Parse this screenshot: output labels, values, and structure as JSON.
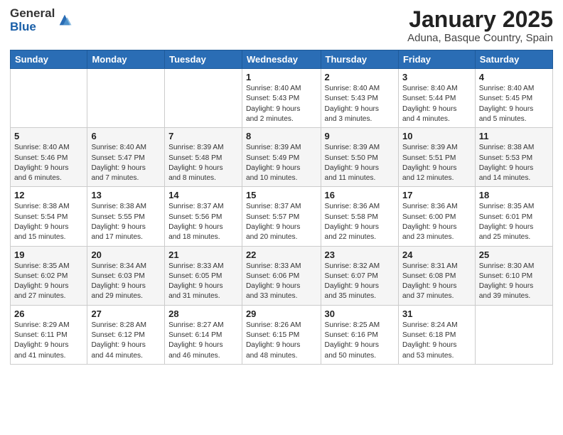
{
  "header": {
    "logo_general": "General",
    "logo_blue": "Blue",
    "title": "January 2025",
    "subtitle": "Aduna, Basque Country, Spain"
  },
  "weekdays": [
    "Sunday",
    "Monday",
    "Tuesday",
    "Wednesday",
    "Thursday",
    "Friday",
    "Saturday"
  ],
  "weeks": [
    [
      {
        "day": "",
        "info": ""
      },
      {
        "day": "",
        "info": ""
      },
      {
        "day": "",
        "info": ""
      },
      {
        "day": "1",
        "info": "Sunrise: 8:40 AM\nSunset: 5:43 PM\nDaylight: 9 hours\nand 2 minutes."
      },
      {
        "day": "2",
        "info": "Sunrise: 8:40 AM\nSunset: 5:43 PM\nDaylight: 9 hours\nand 3 minutes."
      },
      {
        "day": "3",
        "info": "Sunrise: 8:40 AM\nSunset: 5:44 PM\nDaylight: 9 hours\nand 4 minutes."
      },
      {
        "day": "4",
        "info": "Sunrise: 8:40 AM\nSunset: 5:45 PM\nDaylight: 9 hours\nand 5 minutes."
      }
    ],
    [
      {
        "day": "5",
        "info": "Sunrise: 8:40 AM\nSunset: 5:46 PM\nDaylight: 9 hours\nand 6 minutes."
      },
      {
        "day": "6",
        "info": "Sunrise: 8:40 AM\nSunset: 5:47 PM\nDaylight: 9 hours\nand 7 minutes."
      },
      {
        "day": "7",
        "info": "Sunrise: 8:39 AM\nSunset: 5:48 PM\nDaylight: 9 hours\nand 8 minutes."
      },
      {
        "day": "8",
        "info": "Sunrise: 8:39 AM\nSunset: 5:49 PM\nDaylight: 9 hours\nand 10 minutes."
      },
      {
        "day": "9",
        "info": "Sunrise: 8:39 AM\nSunset: 5:50 PM\nDaylight: 9 hours\nand 11 minutes."
      },
      {
        "day": "10",
        "info": "Sunrise: 8:39 AM\nSunset: 5:51 PM\nDaylight: 9 hours\nand 12 minutes."
      },
      {
        "day": "11",
        "info": "Sunrise: 8:38 AM\nSunset: 5:53 PM\nDaylight: 9 hours\nand 14 minutes."
      }
    ],
    [
      {
        "day": "12",
        "info": "Sunrise: 8:38 AM\nSunset: 5:54 PM\nDaylight: 9 hours\nand 15 minutes."
      },
      {
        "day": "13",
        "info": "Sunrise: 8:38 AM\nSunset: 5:55 PM\nDaylight: 9 hours\nand 17 minutes."
      },
      {
        "day": "14",
        "info": "Sunrise: 8:37 AM\nSunset: 5:56 PM\nDaylight: 9 hours\nand 18 minutes."
      },
      {
        "day": "15",
        "info": "Sunrise: 8:37 AM\nSunset: 5:57 PM\nDaylight: 9 hours\nand 20 minutes."
      },
      {
        "day": "16",
        "info": "Sunrise: 8:36 AM\nSunset: 5:58 PM\nDaylight: 9 hours\nand 22 minutes."
      },
      {
        "day": "17",
        "info": "Sunrise: 8:36 AM\nSunset: 6:00 PM\nDaylight: 9 hours\nand 23 minutes."
      },
      {
        "day": "18",
        "info": "Sunrise: 8:35 AM\nSunset: 6:01 PM\nDaylight: 9 hours\nand 25 minutes."
      }
    ],
    [
      {
        "day": "19",
        "info": "Sunrise: 8:35 AM\nSunset: 6:02 PM\nDaylight: 9 hours\nand 27 minutes."
      },
      {
        "day": "20",
        "info": "Sunrise: 8:34 AM\nSunset: 6:03 PM\nDaylight: 9 hours\nand 29 minutes."
      },
      {
        "day": "21",
        "info": "Sunrise: 8:33 AM\nSunset: 6:05 PM\nDaylight: 9 hours\nand 31 minutes."
      },
      {
        "day": "22",
        "info": "Sunrise: 8:33 AM\nSunset: 6:06 PM\nDaylight: 9 hours\nand 33 minutes."
      },
      {
        "day": "23",
        "info": "Sunrise: 8:32 AM\nSunset: 6:07 PM\nDaylight: 9 hours\nand 35 minutes."
      },
      {
        "day": "24",
        "info": "Sunrise: 8:31 AM\nSunset: 6:08 PM\nDaylight: 9 hours\nand 37 minutes."
      },
      {
        "day": "25",
        "info": "Sunrise: 8:30 AM\nSunset: 6:10 PM\nDaylight: 9 hours\nand 39 minutes."
      }
    ],
    [
      {
        "day": "26",
        "info": "Sunrise: 8:29 AM\nSunset: 6:11 PM\nDaylight: 9 hours\nand 41 minutes."
      },
      {
        "day": "27",
        "info": "Sunrise: 8:28 AM\nSunset: 6:12 PM\nDaylight: 9 hours\nand 44 minutes."
      },
      {
        "day": "28",
        "info": "Sunrise: 8:27 AM\nSunset: 6:14 PM\nDaylight: 9 hours\nand 46 minutes."
      },
      {
        "day": "29",
        "info": "Sunrise: 8:26 AM\nSunset: 6:15 PM\nDaylight: 9 hours\nand 48 minutes."
      },
      {
        "day": "30",
        "info": "Sunrise: 8:25 AM\nSunset: 6:16 PM\nDaylight: 9 hours\nand 50 minutes."
      },
      {
        "day": "31",
        "info": "Sunrise: 8:24 AM\nSunset: 6:18 PM\nDaylight: 9 hours\nand 53 minutes."
      },
      {
        "day": "",
        "info": ""
      }
    ]
  ]
}
